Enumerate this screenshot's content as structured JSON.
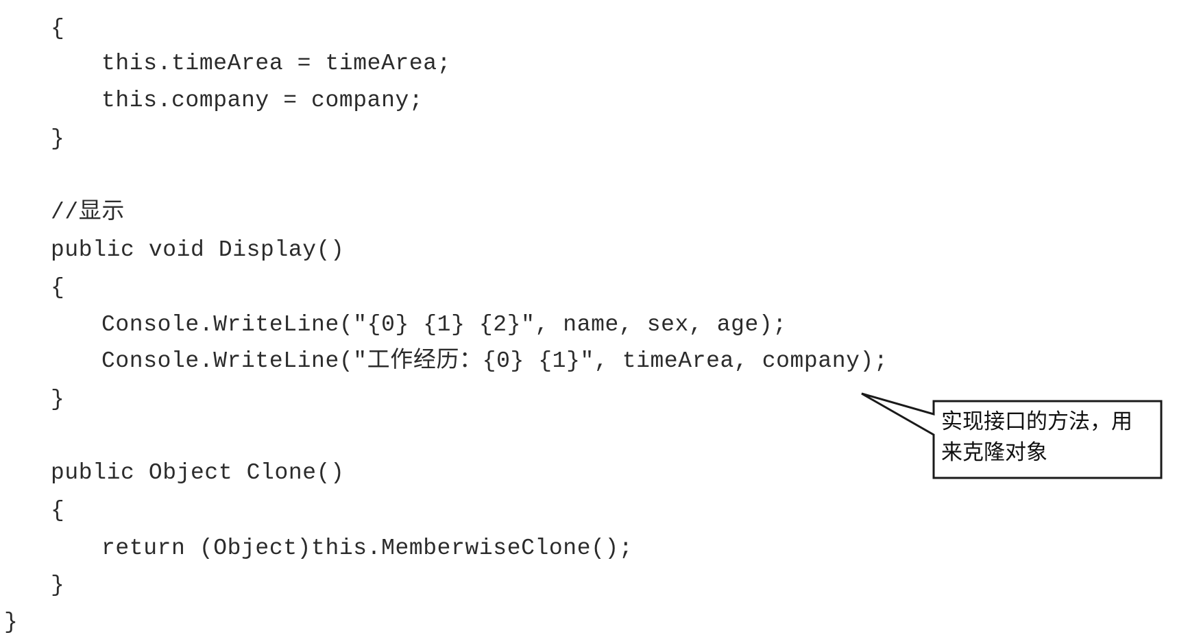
{
  "code": {
    "lines": [
      "{",
      "this.timeArea = timeArea;",
      "this.company = company;",
      "}",
      "//显示",
      "public void Display()",
      "{",
      "Console.WriteLine(\"{0} {1} {2}\", name, sex, age);",
      "Console.WriteLine(\"工作经历：{0} {1}\", timeArea, company);",
      "}",
      "public Object Clone()",
      "{",
      "return (Object)this.MemberwiseClone();",
      "}",
      "}"
    ]
  },
  "callout": {
    "line1": "实现接口的方法，用",
    "line2": "来克隆对象"
  },
  "colors": {
    "text": "#2b2b2b",
    "border": "#1a1a1a",
    "background": "#ffffff"
  }
}
